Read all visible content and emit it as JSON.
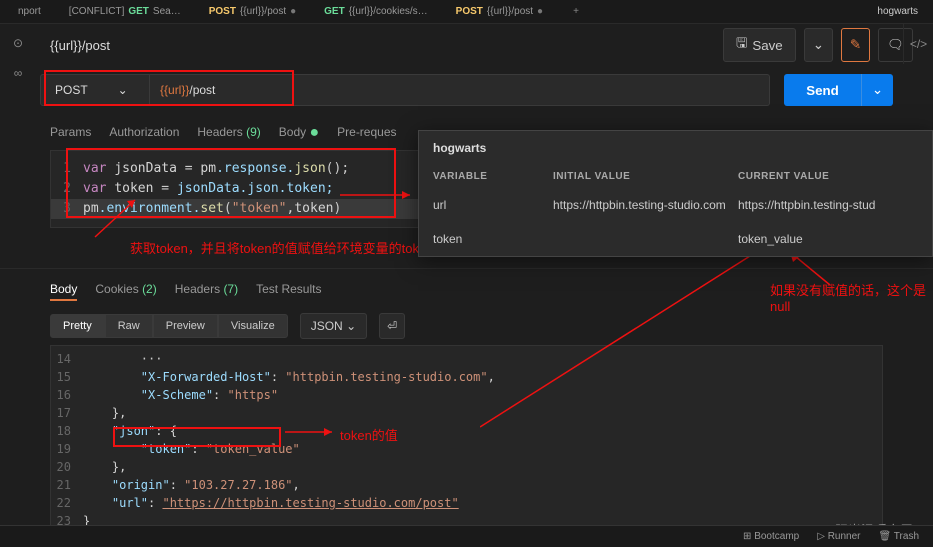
{
  "top_tabs": {
    "import": "nport",
    "conflict": "[CONFLICT]",
    "sea": "Sea…",
    "tab1_method": "POST",
    "tab1_name": "{{url}}/post",
    "tab2_method": "GET",
    "tab2_name": "{{url}}/cookies/s…",
    "tab3_method": "POST",
    "tab3_name": "{{url}}/post",
    "add": "+",
    "env": "hogwarts"
  },
  "breadcrumb": "{{url}}/post",
  "save_label": "Save",
  "method": "POST",
  "url_var": "{{url}}",
  "url_path": "/post",
  "send_label": "Send",
  "req_tabs": {
    "params": "Params",
    "auth": "Authorization",
    "headers": "Headers",
    "headers_count": "(9)",
    "body": "Body",
    "prereq": "Pre-reques"
  },
  "script": {
    "l1_var": "var",
    "l1_id": "jsonData",
    "l1_eq": " = ",
    "l1_pm": "pm",
    "l1_resp": ".response.",
    "l1_json": "json",
    "l1_end": "();",
    "l2_var": "var",
    "l2_id": "token",
    "l2_eq": " = ",
    "l2_expr": "jsonData.json.token;",
    "l3_pm": "pm",
    "l3_env": ".environment.",
    "l3_set": "set",
    "l3_open": "(",
    "l3_str": "\"token\"",
    "l3_comma": ",token",
    "l3_close": ")"
  },
  "annotation1": "获取token，并且将token的值赋值给环境变量的token",
  "annotation2": "token的值",
  "annotation3": "如果没有赋值的话，这个是null",
  "resp_tabs": {
    "body": "Body",
    "cookies": "Cookies",
    "cookies_count": "(2)",
    "headers": "Headers",
    "headers_count": "(7)",
    "tests": "Test Results"
  },
  "views": {
    "pretty": "Pretty",
    "raw": "Raw",
    "preview": "Preview",
    "visualize": "Visualize",
    "format": "JSON"
  },
  "resp_lines": {
    "l15_key": "\"X-Forwarded-Host\"",
    "l15_val": "\"httpbin.testing-studio.com\"",
    "l16_key": "\"X-Scheme\"",
    "l16_val": "\"https\"",
    "l18_key": "\"json\"",
    "l19_key": "\"token\"",
    "l19_val": "\"token_value\"",
    "l21_key": "\"origin\"",
    "l21_val": "\"103.27.27.186\"",
    "l22_key": "\"url\"",
    "l22_val": "\"https://httpbin.testing-studio.com/post\""
  },
  "line_nums": [
    "14",
    "15",
    "16",
    "17",
    "18",
    "19",
    "20",
    "21",
    "22",
    "23"
  ],
  "env_popup": {
    "title": "hogwarts",
    "th_var": "VARIABLE",
    "th_init": "INITIAL VALUE",
    "th_cur": "CURRENT VALUE",
    "row1_var": "url",
    "row1_init": "https://httpbin.testing-studio.com",
    "row1_cur": "https://httpbin.testing-stud",
    "row2_var": "token",
    "row2_cur": "token_value"
  },
  "bottom": {
    "bootcamp": "⊞ Bootcamp",
    "runner": "▷ Runner",
    "trash": "🗑 Trash"
  },
  "watermark": "CSDN @阳光温暖空屋"
}
